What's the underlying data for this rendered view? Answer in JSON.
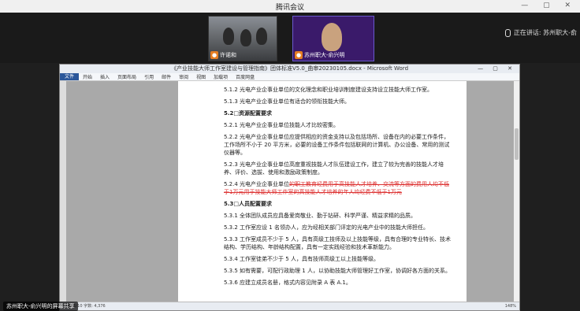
{
  "app": {
    "title": "腾讯会议"
  },
  "video": {
    "tile1": {
      "name": "许诺和"
    },
    "tile2": {
      "name": "苏州职大-俞兴明"
    },
    "speaking": "正在讲话: 苏州职大-俞"
  },
  "word": {
    "title": "《产业技能大师工作室建设与管理指南》团体标准V5.0_曲审20230105.docx - Microsoft Word",
    "ribbon": [
      "文件",
      "开始",
      "插入",
      "页面布局",
      "引用",
      "邮件",
      "审阅",
      "视图",
      "加载项",
      "百度网盘"
    ],
    "status_left": "页面: 6/10  字数: 4,376",
    "status_right": "148%",
    "lines": [
      {
        "text": "5.1.2 光电产业企事业单位的文化理念和职业培训制度建设支持设立技能大师工作室。",
        "type": "normal"
      },
      {
        "text": "5.1.3 光电产业企事业单位有适合的领衔技能大师。",
        "type": "normal"
      },
      {
        "text": "5.2□资源配置要求",
        "type": "heading"
      },
      {
        "text": "5.2.1 光电产业企事业单位技能人才比较密集。",
        "type": "normal"
      },
      {
        "text": "5.2.2 光电产业企事业单位应提供相应的资金支持以及包括场所、设备在内的必要工作条件，工作场所不小于 20 平方米，必要的设备工作条件包括联网的计算机、办公设备、常用的测试仪器等。",
        "type": "normal"
      },
      {
        "text": "5.2.3 光电产业企事业单位高度重视技能人才队伍建设工作，建立了较为完善的技能人才培养、评价、选拔、使用和激励政策制度。",
        "type": "normal"
      }
    ],
    "line524_prefix": "5.2.4 光电产业企事业单位",
    "line524_deleted": "的职工教育经费用于高技能人才培养、交流等方面的费用人均不低于1万元用于技能大师工作室的高技能人才培养的年人均经费不低于1万元",
    "heading53": "5.3□人员配置要求",
    "lines53": [
      {
        "text": "5.3.1 全体团队成员应具备爱岗敬业、勤于钻研、科学严谨、精益求精的品质。",
        "type": "normal"
      },
      {
        "text": "5.3.2 工作室应设 1 名领办人，应为经相关部门评定的光电产业中的技能大师担任。",
        "type": "normal"
      },
      {
        "text": "5.3.3 工作室成员不少于 5 人，具有高级工技师及以上技能等级，具有合理的专业特长、技术结构、学历结构、年龄结构配置，具有一定实践经验和技术革新能力。",
        "type": "normal"
      },
      {
        "text": "5.3.4 工作室徒弟不少于 5 人，具有技师高级工以上技能等级。",
        "type": "normal"
      },
      {
        "text": "5.3.5 如有需要，可配行政助理 1 人，以协助技能大师管理好工作室，协调好各方面的关系。",
        "type": "normal"
      },
      {
        "text": "5.3.6 应建立成员名册，格式内容见附录 A 表 A.1。",
        "type": "normal"
      }
    ]
  },
  "share": {
    "label": "苏州职大-俞兴明的屏幕共享"
  }
}
